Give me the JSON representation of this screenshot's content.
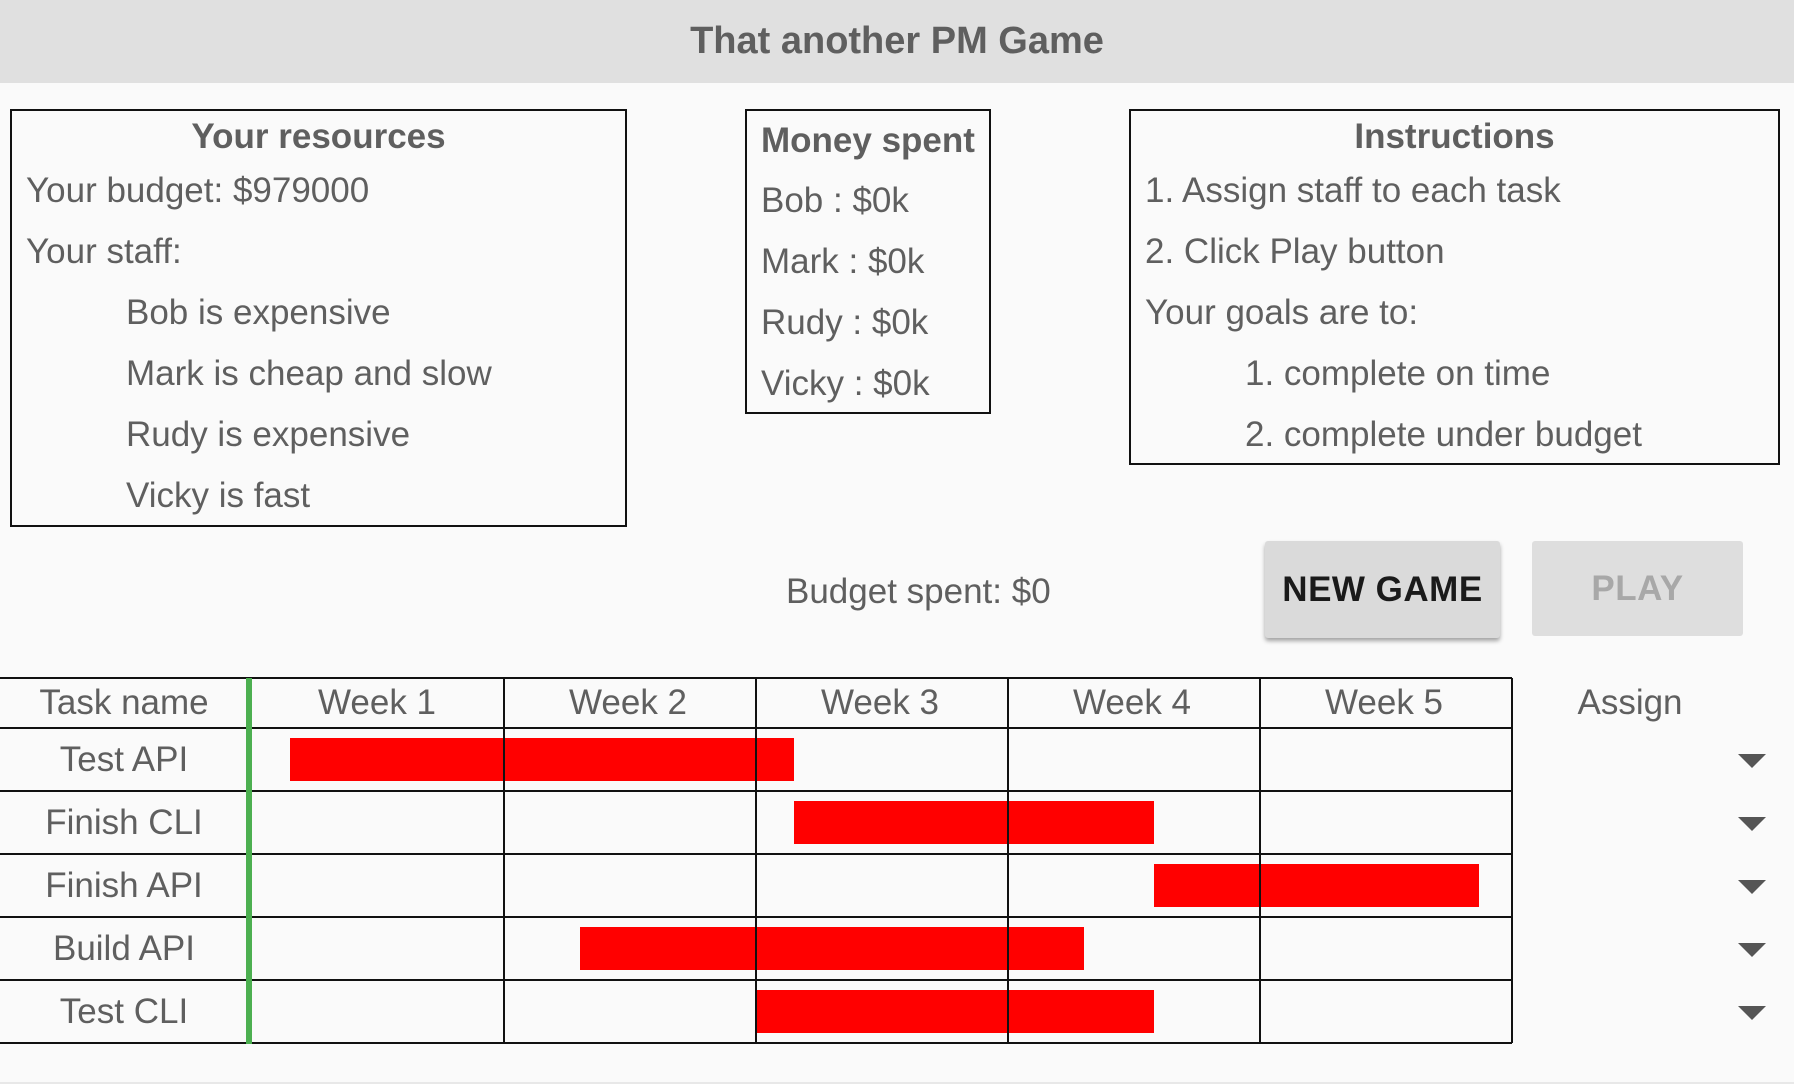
{
  "title": "That another PM Game",
  "resources": {
    "title": "Your resources",
    "budget": "Your budget: $979000",
    "staff_label": "Your staff:",
    "staff": [
      "Bob is expensive",
      "Mark is cheap and slow",
      "Rudy is expensive",
      "Vicky is fast"
    ]
  },
  "money": {
    "title": "Money spent",
    "items": [
      "Bob : $0k",
      "Mark : $0k",
      "Rudy : $0k",
      "Vicky : $0k"
    ]
  },
  "instructions": {
    "title": "Instructions",
    "steps": [
      "1. Assign staff to each task",
      "2. Click Play button"
    ],
    "goals_label": "Your goals are to:",
    "goals": [
      "1. complete on time",
      "2. complete under budget"
    ]
  },
  "budget_spent": "Budget spent: $0",
  "buttons": {
    "new_game": "NEW GAME",
    "play": "PLAY"
  },
  "gantt": {
    "task_header": "Task name",
    "assign_header": "Assign",
    "weeks": [
      "Week 1",
      "Week 2",
      "Week 3",
      "Week 4",
      "Week 5"
    ],
    "tasks": [
      {
        "name": "Test API",
        "start_week": 0.15,
        "end_week": 2.15
      },
      {
        "name": "Finish CLI",
        "start_week": 2.15,
        "end_week": 3.58
      },
      {
        "name": "Finish API",
        "start_week": 3.58,
        "end_week": 4.87
      },
      {
        "name": "Build API",
        "start_week": 1.3,
        "end_week": 3.3
      },
      {
        "name": "Test CLI",
        "start_week": 2.0,
        "end_week": 3.58
      }
    ]
  },
  "colors": {
    "bar": "#ff0000",
    "today_line": "#4caf50"
  }
}
